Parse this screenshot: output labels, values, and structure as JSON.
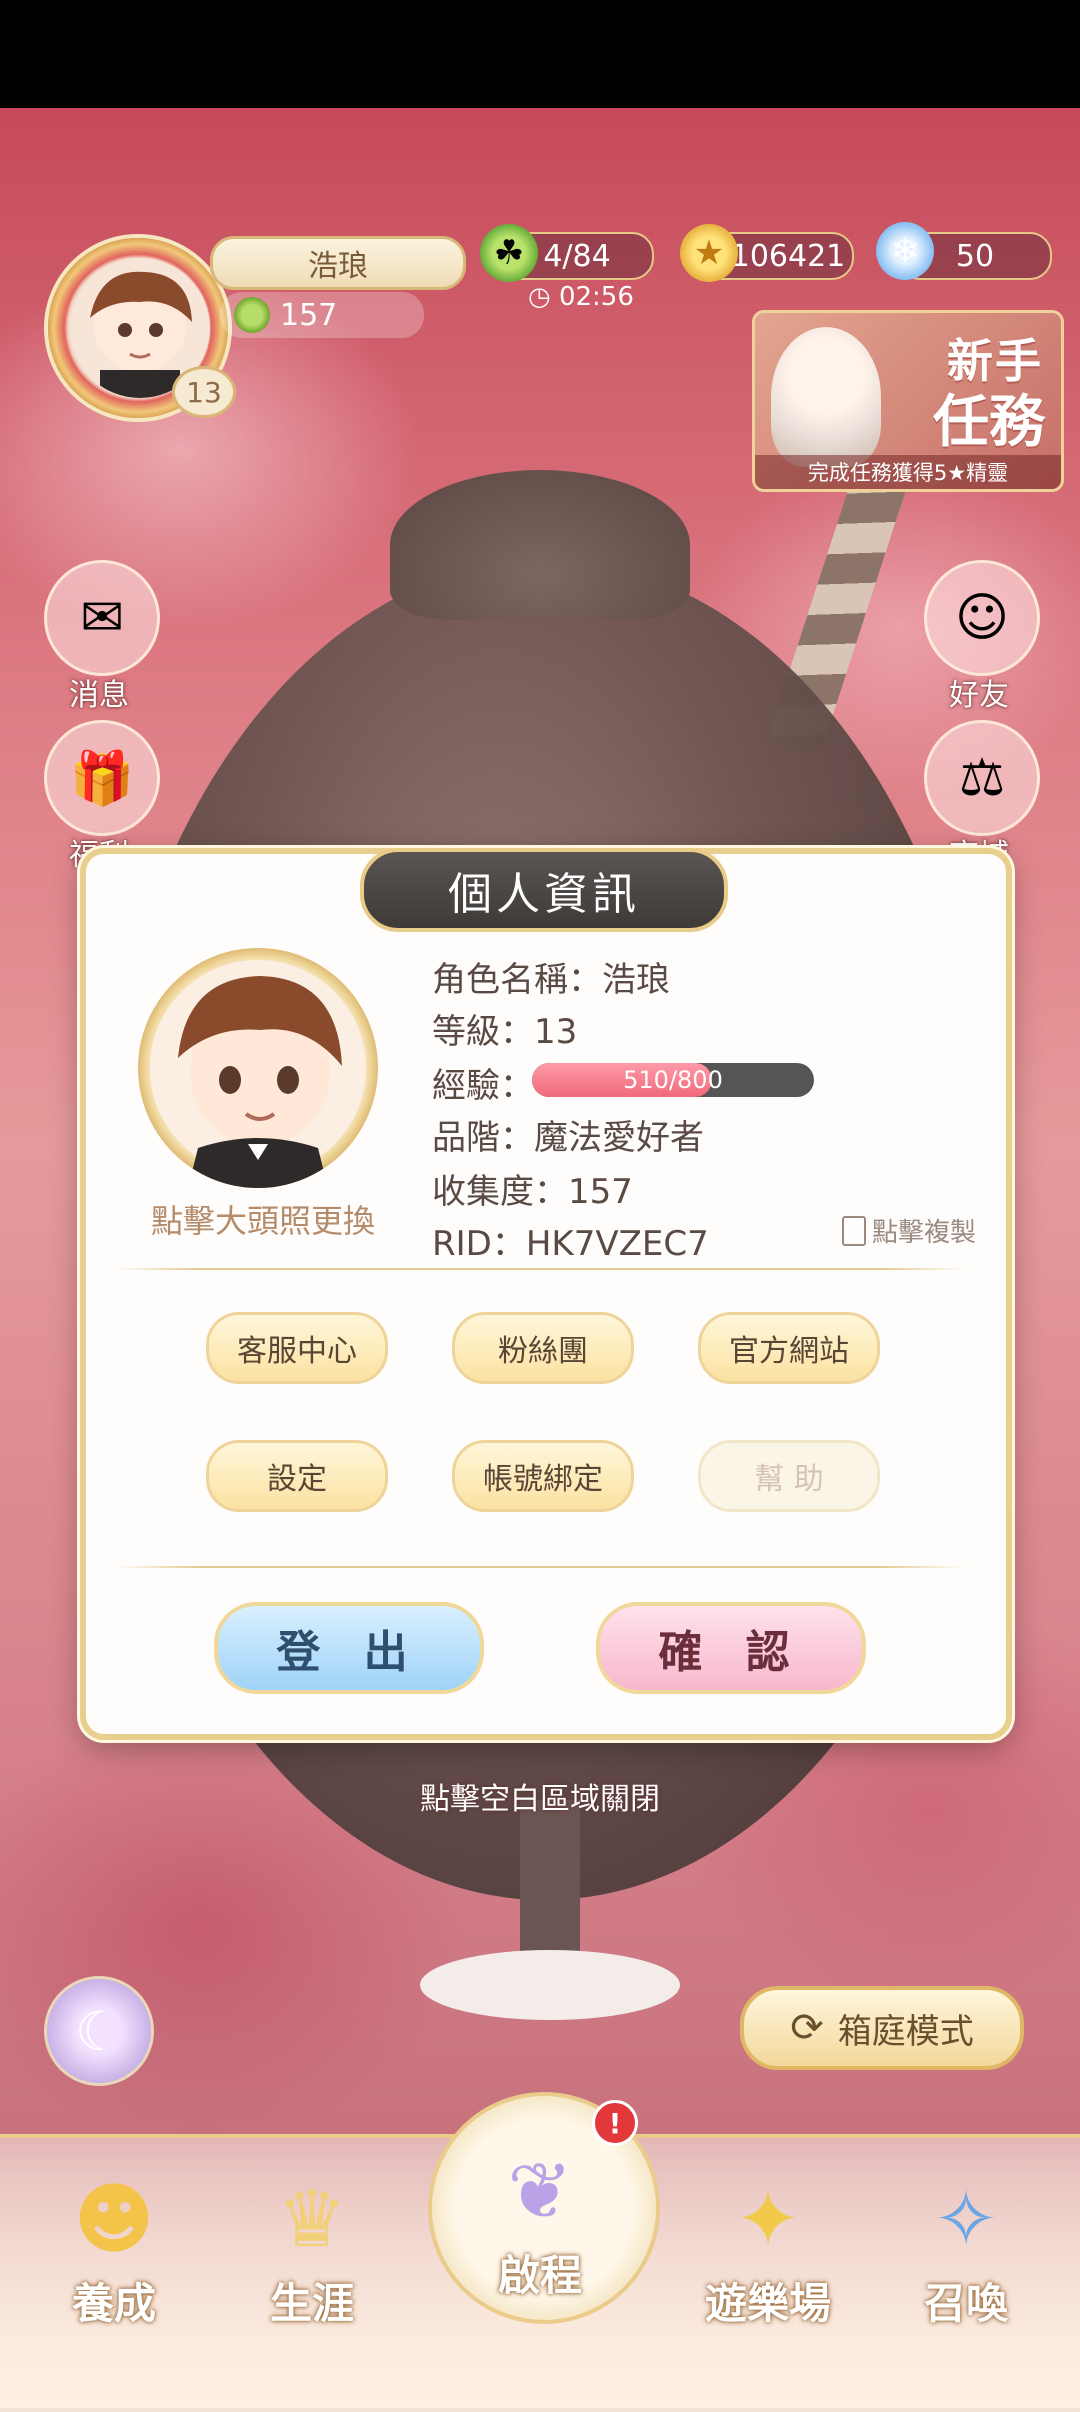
{
  "player": {
    "name": "浩琅",
    "collection": "157",
    "level": "13"
  },
  "resources": {
    "stamina": "4/84",
    "stamina_timer": "02:56",
    "coins": "106421",
    "gems": "50"
  },
  "task_banner": {
    "title_line1": "新手",
    "title_line2": "任務",
    "caption": "完成任務獲得5★精靈"
  },
  "side_left": [
    "消息",
    "福利"
  ],
  "side_right": [
    "好友",
    "商城"
  ],
  "dialog": {
    "title": "個人資訊",
    "change_avatar": "點擊大頭照更換",
    "name_line": "角色名稱：浩琅",
    "level_line": "等級：13",
    "exp_label": "經驗：",
    "exp_text": "510/800",
    "exp_fraction": 0.6375,
    "rank_line": "品階：魔法愛好者",
    "collection_line": "收集度：157",
    "rid_line": "RID：HK7VZEC7",
    "copy_label": "點擊複製",
    "buttons_row1": [
      "客服中心",
      "粉絲團",
      "官方網站"
    ],
    "buttons_row2": [
      "設定",
      "帳號綁定",
      "幫 助"
    ],
    "logout": "登 出",
    "confirm": "確 認"
  },
  "close_hint": "點擊空白區域關閉",
  "mode_button": "箱庭模式",
  "nav": [
    "養成",
    "生涯",
    "啟程",
    "遊樂場",
    "召喚"
  ],
  "nav_badge": "!",
  "colors": {
    "accent_gold": "#e9cf8e",
    "exp_fill": "#f06a7b",
    "logout_blue": "#9fd3f7",
    "confirm_pink": "#f8b7cc"
  }
}
